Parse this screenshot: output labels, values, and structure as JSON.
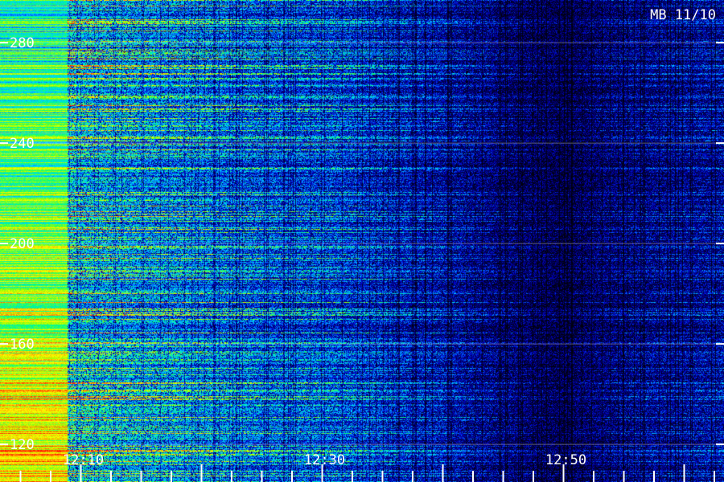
{
  "chart_data": {
    "type": "heatmap",
    "title": "MB 11/10",
    "xlabel": "",
    "ylabel": "",
    "x_ticks": [
      {
        "value": "12:10",
        "minutes": 10,
        "label": "12:10"
      },
      {
        "value": "12:30",
        "minutes": 30,
        "label": "12:30"
      },
      {
        "value": "12:50",
        "minutes": 50,
        "label": "12:50"
      }
    ],
    "x_range_minutes": [
      3.3,
      63.3
    ],
    "y_ticks": [
      {
        "value": 280,
        "label": "280"
      },
      {
        "value": 240,
        "label": "240"
      },
      {
        "value": 200,
        "label": "200"
      },
      {
        "value": 160,
        "label": "160"
      },
      {
        "value": 120,
        "label": "120"
      }
    ],
    "ylim": [
      105,
      297
    ],
    "colormap": [
      "#000010",
      "#000060",
      "#0000c8",
      "#0060ff",
      "#00d8ff",
      "#00ff80",
      "#a0ff00",
      "#ffff00",
      "#ff8000",
      "#ff0000"
    ],
    "intensity_profile": {
      "minutes": [
        3.3,
        10,
        15,
        20,
        25,
        30,
        35,
        40,
        45,
        50,
        55,
        63.3
      ],
      "level": [
        0.8,
        0.55,
        0.48,
        0.44,
        0.38,
        0.36,
        0.3,
        0.24,
        0.16,
        0.1,
        0.18,
        0.22
      ]
    },
    "grid": false,
    "legend": "none"
  }
}
